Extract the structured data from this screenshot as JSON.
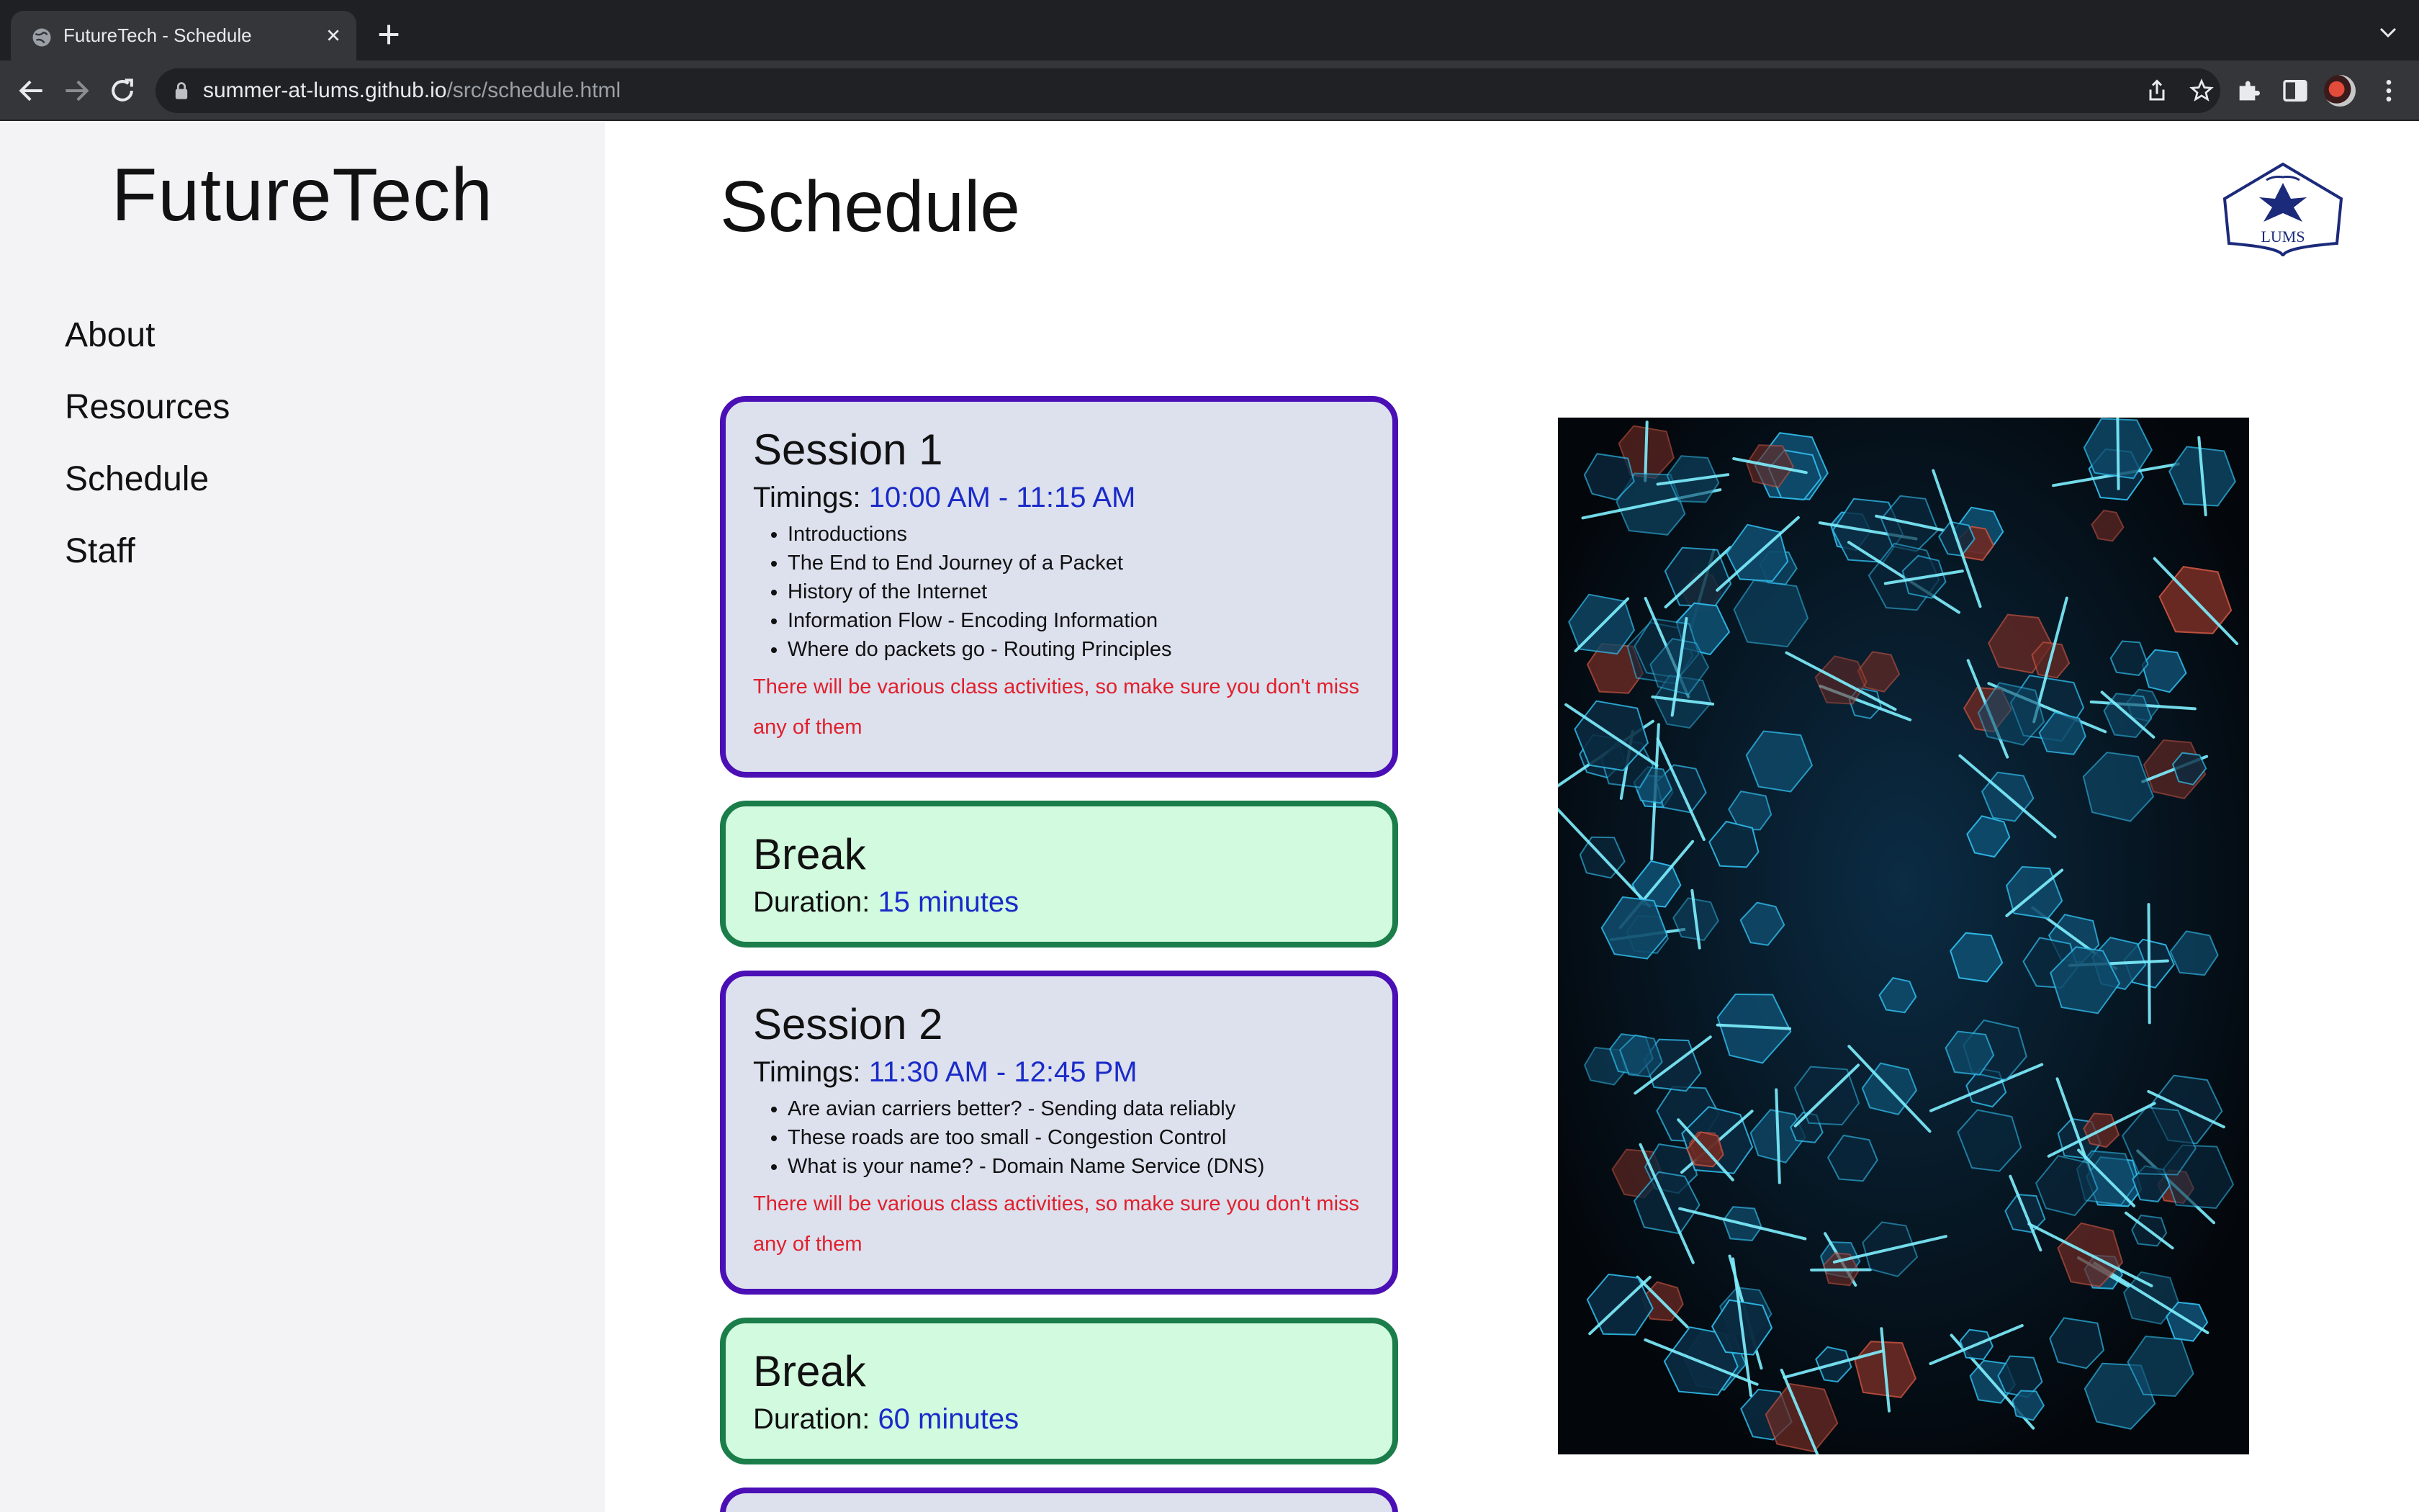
{
  "browser": {
    "tab_title": "FutureTech - Schedule",
    "url_domain": "summer-at-lums.github.io",
    "url_path": "/src/schedule.html"
  },
  "sidebar": {
    "brand": "FutureTech",
    "nav": [
      "About",
      "Resources",
      "Schedule",
      "Staff"
    ]
  },
  "main": {
    "title": "Schedule",
    "logo_text": "LUMS",
    "cards": [
      {
        "type": "session",
        "title": "Session 1",
        "meta_label": "Timings:",
        "meta_value": "10:00 AM - 11:15 AM",
        "topics": [
          "Introductions",
          "The End to End Journey of a Packet",
          "History of the Internet",
          "Information Flow - Encoding Information",
          "Where do packets go - Routing Principles"
        ],
        "note": "There will be various class activities, so make sure you don't miss any of them"
      },
      {
        "type": "break",
        "title": "Break",
        "meta_label": "Duration:",
        "meta_value": "15 minutes"
      },
      {
        "type": "session",
        "title": "Session 2",
        "meta_label": "Timings:",
        "meta_value": "11:30 AM - 12:45 PM",
        "topics": [
          "Are avian carriers better? - Sending data reliably",
          "These roads are too small - Congestion Control",
          "What is your name? - Domain Name Service (DNS)"
        ],
        "note": "There will be various class activities, so make sure you don't miss any of them"
      },
      {
        "type": "break",
        "title": "Break",
        "meta_label": "Duration:",
        "meta_value": "60 minutes"
      }
    ]
  },
  "colors": {
    "session_border": "#4a0fb5",
    "session_bg": "#dde1ee",
    "break_border": "#1a7d4a",
    "break_bg": "#d2fadf",
    "value_blue": "#1a2bc9",
    "note_red": "#e0202c",
    "sidebar_bg": "#f3f3f5"
  }
}
